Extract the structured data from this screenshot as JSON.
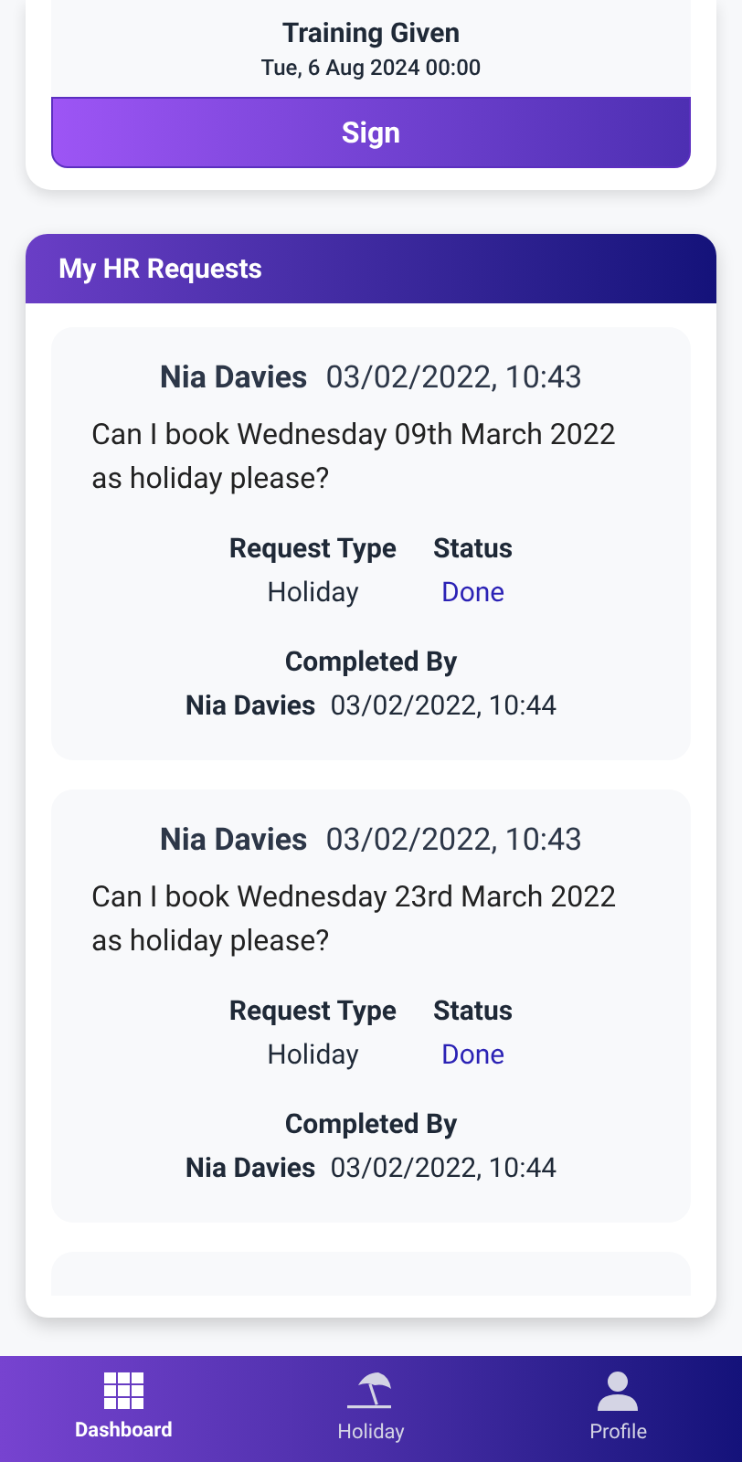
{
  "training": {
    "title": "Training Given",
    "date": "Tue, 6 Aug 2024 00:00",
    "button": "Sign"
  },
  "hr_requests": {
    "title": "My HR Requests",
    "requests": [
      {
        "name": "Nia Davies",
        "datetime": "03/02/2022, 10:43",
        "message": "Can I book Wednesday 09th March 2022 as holiday please?",
        "type_label": "Request Type",
        "status_label": "Status",
        "type": "Holiday",
        "status": "Done",
        "completed_label": "Completed By",
        "completed_name": "Nia Davies",
        "completed_at": "03/02/2022, 10:44"
      },
      {
        "name": "Nia Davies",
        "datetime": "03/02/2022, 10:43",
        "message": "Can I book Wednesday 23rd March 2022 as holiday please?",
        "type_label": "Request Type",
        "status_label": "Status",
        "type": "Holiday",
        "status": "Done",
        "completed_label": "Completed By",
        "completed_name": "Nia Davies",
        "completed_at": "03/02/2022, 10:44"
      }
    ]
  },
  "nav": [
    {
      "label": "Dashboard",
      "kind": "grid",
      "selected": true
    },
    {
      "label": "Holiday",
      "kind": "umbrella",
      "selected": false
    },
    {
      "label": "Profile",
      "kind": "person",
      "selected": false
    }
  ]
}
